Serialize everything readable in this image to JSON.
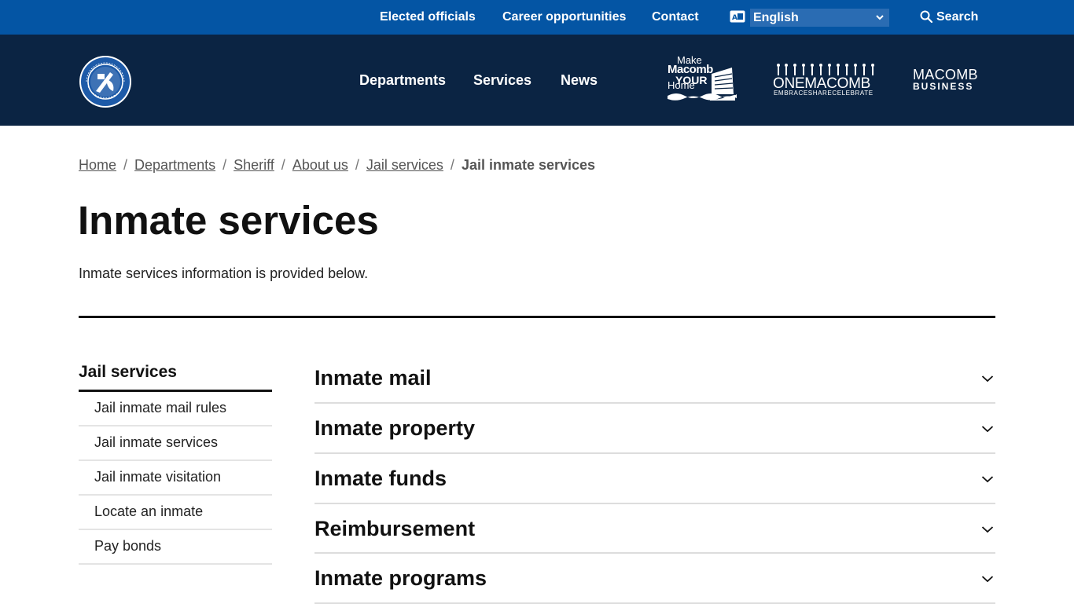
{
  "utility": {
    "links": [
      {
        "label": "Elected officials"
      },
      {
        "label": "Career opportunities"
      },
      {
        "label": "Contact"
      }
    ],
    "language": "English",
    "search_label": "Search"
  },
  "header": {
    "nav": [
      {
        "label": "Departments"
      },
      {
        "label": "Services"
      },
      {
        "label": "News"
      }
    ],
    "partners": {
      "make_macomb_your_home": {
        "l1": "Make",
        "l2": "Macomb",
        "l3": "YOUR",
        "l4": "Home"
      },
      "one_macomb": {
        "l1": "ONEMACOMB",
        "l2": "EMBRACESHARECELEBRATE"
      },
      "macomb_business": {
        "l1": "MACOMB",
        "l2": "BUSINESS"
      }
    }
  },
  "breadcrumb": {
    "items": [
      {
        "label": "Home"
      },
      {
        "label": "Departments"
      },
      {
        "label": "Sheriff"
      },
      {
        "label": "About us"
      },
      {
        "label": "Jail services"
      }
    ],
    "current": "Jail inmate services",
    "separator": "/"
  },
  "page": {
    "title": "Inmate services",
    "intro": "Inmate services information is provided below."
  },
  "sidebar": {
    "title": "Jail services",
    "items": [
      {
        "label": "Jail inmate mail rules"
      },
      {
        "label": "Jail inmate services"
      },
      {
        "label": "Jail inmate visitation"
      },
      {
        "label": "Locate an inmate"
      },
      {
        "label": "Pay bonds"
      }
    ]
  },
  "accordion": {
    "items": [
      {
        "title": "Inmate mail"
      },
      {
        "title": "Inmate property"
      },
      {
        "title": "Inmate funds"
      },
      {
        "title": "Reimbursement"
      },
      {
        "title": "Inmate programs"
      }
    ]
  },
  "colors": {
    "utility_bar": "#0455a4",
    "header": "#0b2443",
    "text": "#111111"
  }
}
